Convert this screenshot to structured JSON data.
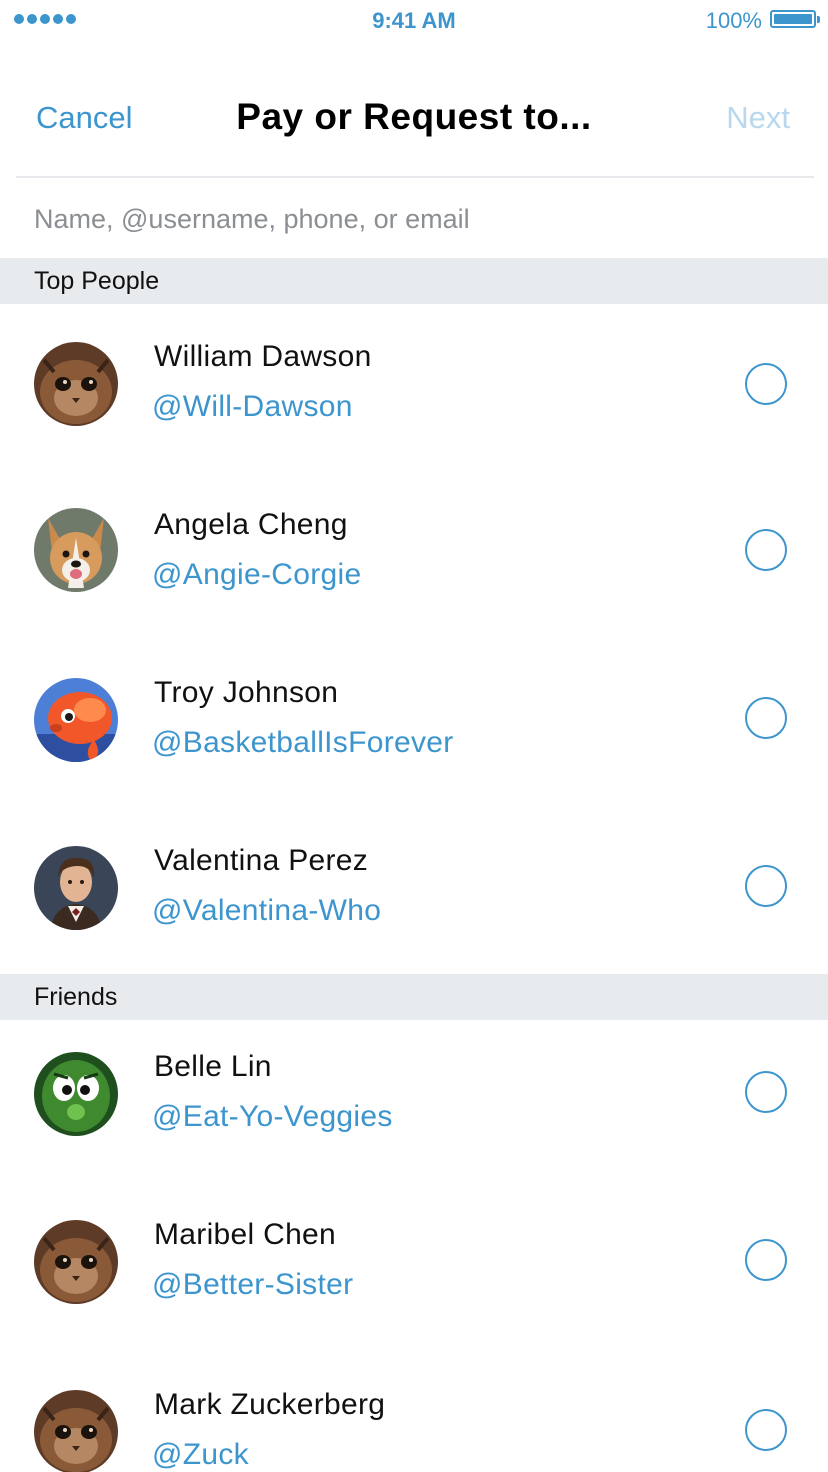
{
  "status_bar": {
    "time": "9:41 AM",
    "battery": "100%"
  },
  "nav": {
    "cancel_label": "Cancel",
    "title": "Pay or Request to...",
    "next_label": "Next"
  },
  "search": {
    "placeholder": "Name, @username, phone, or email",
    "value": ""
  },
  "sections": {
    "top_people": {
      "title": "Top People",
      "people": [
        {
          "name": "William Dawson",
          "handle": "@Will-Dawson",
          "avatar": "cat-avatar"
        },
        {
          "name": "Angela Cheng",
          "handle": "@Angie-Corgie",
          "avatar": "corgi-avatar"
        },
        {
          "name": "Troy Johnson",
          "handle": "@BasketballIsForever",
          "avatar": "goldfish-avatar"
        },
        {
          "name": "Valentina Perez",
          "handle": "@Valentina-Who",
          "avatar": "man-avatar"
        }
      ]
    },
    "friends": {
      "title": "Friends",
      "people": [
        {
          "name": "Belle Lin",
          "handle": "@Eat-Yo-Veggies",
          "avatar": "cucumber-avatar"
        },
        {
          "name": "Maribel Chen",
          "handle": "@Better-Sister",
          "avatar": "cat-avatar"
        },
        {
          "name": "Mark Zuckerberg",
          "handle": "@Zuck",
          "avatar": "cat-avatar"
        }
      ]
    }
  },
  "colors": {
    "accent": "#3d95ce",
    "accent_disabled": "#b9d8ee",
    "section_bg": "#e8ebee"
  }
}
